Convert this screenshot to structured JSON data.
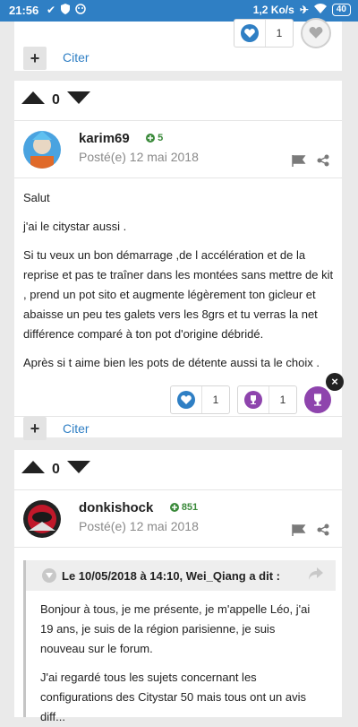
{
  "status_bar": {
    "time": "21:56",
    "network_speed": "1,2 Ko/s",
    "battery": "40"
  },
  "card1": {
    "like_count": "1",
    "quote_label": "Citer"
  },
  "post1": {
    "vote_count": "0",
    "author": "karim69",
    "reputation": "5",
    "posted": "Posté(e) 12 mai 2018",
    "paragraphs": [
      "Salut",
      "j'ai le citystar aussi .",
      "Si tu veux un bon démarrage ,de l accélération et de la reprise et pas te traîner dans les montées sans mettre de kit  , prend un pot sito et augmente légèrement ton gicleur et abaisse un peu tes galets vers les 8grs et tu verras la net différence comparé à ton pot d'origine débridé.",
      "Après si t aime bien les pots de détente aussi ta le choix ."
    ],
    "like_count": "1",
    "trophy_count": "1",
    "quote_label": "Citer",
    "close_symbol": "×"
  },
  "post2": {
    "vote_count": "0",
    "author": "donkishock",
    "reputation": "851",
    "posted": "Posté(e) 12 mai 2018",
    "quote_header": "Le 10/05/2018 à 14:10, Wei_Qiang a dit :",
    "quote_paragraphs": [
      "Bonjour à tous, je me présente, je m'appelle Léo, j'ai 19 ans, je suis de la région parisienne, je suis nouveau sur le forum.",
      "J'ai regardé tous les sujets concernant les configurations des Citystar 50 mais tous ont un avis diff..."
    ]
  },
  "colors": {
    "status_bar": "#2f7fc4",
    "link": "#2f7fc4",
    "reputation": "#3b8a3b",
    "trophy": "#8e44ad",
    "like": "#2f7fc4"
  },
  "icons": [
    "check-icon",
    "shield-icon",
    "face-icon",
    "airplane-mode-icon",
    "wifi-icon",
    "heart-icon",
    "trophy-icon",
    "flag-icon",
    "share-icon",
    "upvote-icon",
    "downvote-icon",
    "plus-icon",
    "chevron-down-icon",
    "reply-icon"
  ]
}
